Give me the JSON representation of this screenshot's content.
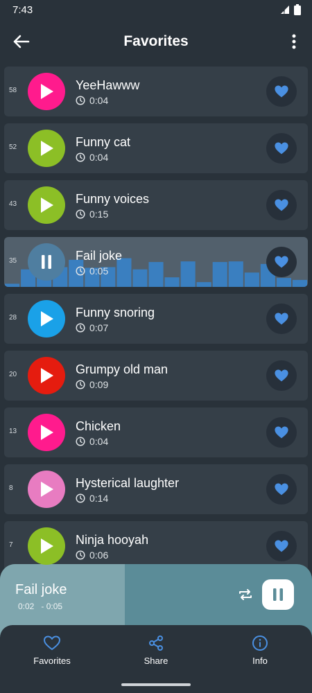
{
  "status": {
    "time": "7:43"
  },
  "app_bar": {
    "title": "Favorites"
  },
  "sounds": [
    {
      "rank": "58",
      "title": "YeeHawww",
      "duration": "0:04",
      "color": "#ff1b8d",
      "state": "play"
    },
    {
      "rank": "52",
      "title": "Funny cat",
      "duration": "0:04",
      "color": "#8cbf26",
      "state": "play"
    },
    {
      "rank": "43",
      "title": "Funny voices",
      "duration": "0:15",
      "color": "#8cbf26",
      "state": "play"
    },
    {
      "rank": "35",
      "title": "Fail joke",
      "duration": "0:05",
      "color": "#4f7ea0",
      "state": "pause"
    },
    {
      "rank": "28",
      "title": "Funny snoring",
      "duration": "0:07",
      "color": "#1aa1e8",
      "state": "play"
    },
    {
      "rank": "20",
      "title": "Grumpy old man",
      "duration": "0:09",
      "color": "#e51c0f",
      "state": "play"
    },
    {
      "rank": "13",
      "title": "Chicken",
      "duration": "0:04",
      "color": "#ff1b8d",
      "state": "play"
    },
    {
      "rank": "8",
      "title": "Hysterical laughter",
      "duration": "0:14",
      "color": "#e87cc1",
      "state": "play"
    },
    {
      "rank": "7",
      "title": "Ninja hooyah",
      "duration": "0:06",
      "color": "#8cbf26",
      "state": "play"
    }
  ],
  "waveform_levels": [
    0.1,
    0.55,
    0.72,
    0.62,
    0.85,
    0.6,
    0.62,
    0.9,
    0.55,
    0.78,
    0.3,
    0.8,
    0.15,
    0.78,
    0.8,
    0.45,
    0.72,
    0.28,
    0.22
  ],
  "waveform_color": "#3a7fc0",
  "player": {
    "title": "Fail joke",
    "time_text": "0:02   - 0:05",
    "progress": 0.4
  },
  "nav": {
    "favorites": "Favorites",
    "share": "Share",
    "info": "Info"
  },
  "colors": {
    "accent": "#4a90e2",
    "background": "#29323a",
    "card": "#353f48"
  }
}
